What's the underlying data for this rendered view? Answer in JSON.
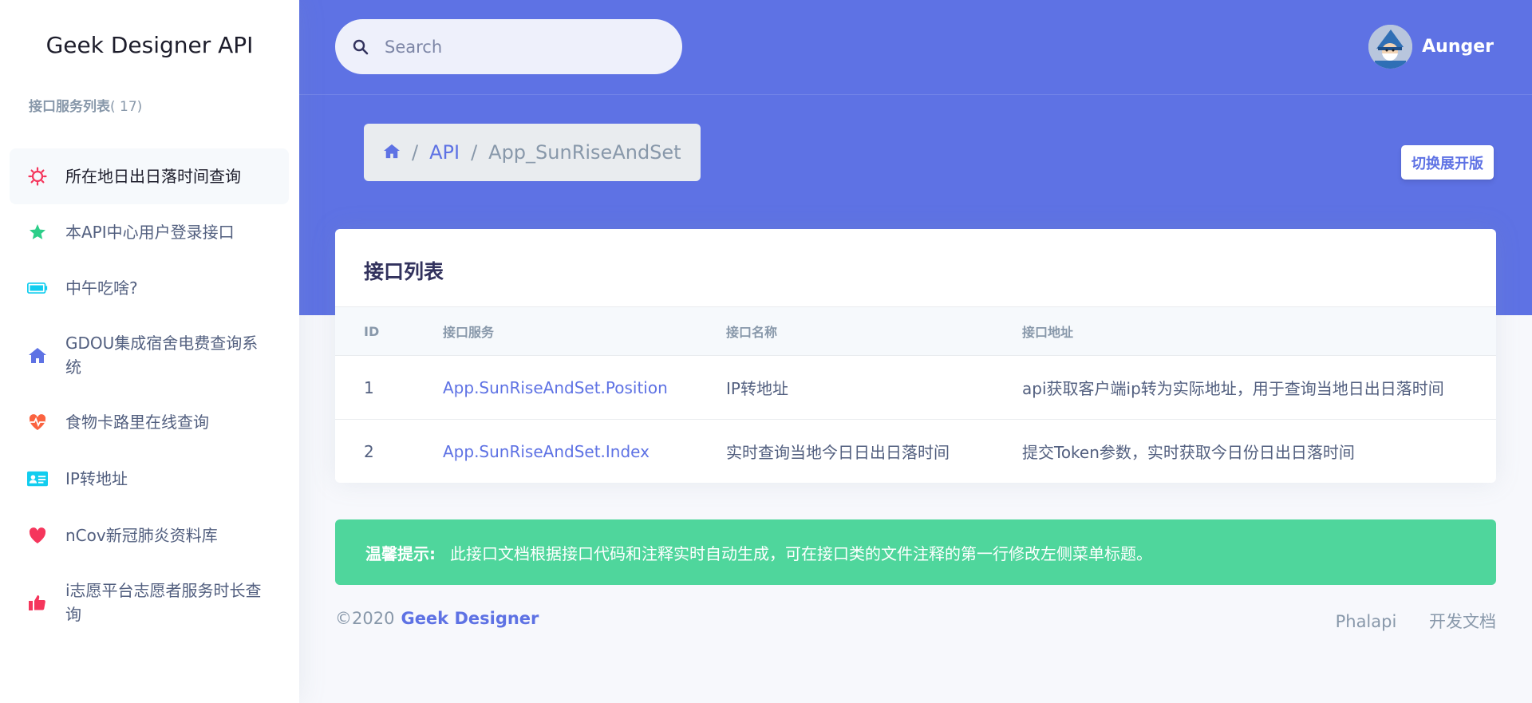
{
  "sidebar": {
    "brand": "Geek Designer API",
    "heading": "接口服务列表",
    "heading_count": "( 17)",
    "items": [
      {
        "label": "所在地日出日落时间查询",
        "icon": "sun-icon",
        "color": "#f5365c"
      },
      {
        "label": "本API中心用户登录接口",
        "icon": "star-icon",
        "color": "#2dce89"
      },
      {
        "label": "中午吃啥?",
        "icon": "battery-icon",
        "color": "#11cdef"
      },
      {
        "label": "GDOU集成宿舍电费查询系统",
        "icon": "home-icon",
        "color": "#5e72e4"
      },
      {
        "label": "食物卡路里在线查询",
        "icon": "heart-pulse-icon",
        "color": "#fb6340"
      },
      {
        "label": "IP转地址",
        "icon": "id-card-icon",
        "color": "#11cdef"
      },
      {
        "label": "nCov新冠肺炎资料库",
        "icon": "heart-icon",
        "color": "#f5365c"
      },
      {
        "label": "i志愿平台志愿者服务时长查询",
        "icon": "thumbs-up-icon",
        "color": "#f5365c"
      }
    ]
  },
  "search": {
    "placeholder": "Search"
  },
  "user": {
    "name": "Aunger"
  },
  "breadcrumb": {
    "home_icon": "home-icon",
    "items": [
      "API",
      "App_SunRiseAndSet"
    ]
  },
  "toggle_button": "切换展开版",
  "card": {
    "title": "接口列表",
    "columns": [
      "ID",
      "接口服务",
      "接口名称",
      "接口地址"
    ],
    "rows": [
      {
        "id": "1",
        "service": "App.SunRiseAndSet.Position",
        "name": "IP转地址",
        "desc": "api获取客户端ip转为实际地址，用于查询当地日出日落时间"
      },
      {
        "id": "2",
        "service": "App.SunRiseAndSet.Index",
        "name": "实时查询当地今日日出日落时间",
        "desc": "提交Token参数，实时获取今日份日出日落时间"
      }
    ]
  },
  "alert": {
    "label": "温馨提示:",
    "text": "此接口文档根据接口代码和注释实时自动生成，可在接口类的文件注释的第一行修改左侧菜单标题。"
  },
  "footer": {
    "copyright": "©2020",
    "brand": "Geek Designer",
    "links": [
      "Phalapi",
      "开发文档"
    ]
  },
  "colors": {
    "primary": "#5e72e4",
    "success": "#4fd69c"
  }
}
